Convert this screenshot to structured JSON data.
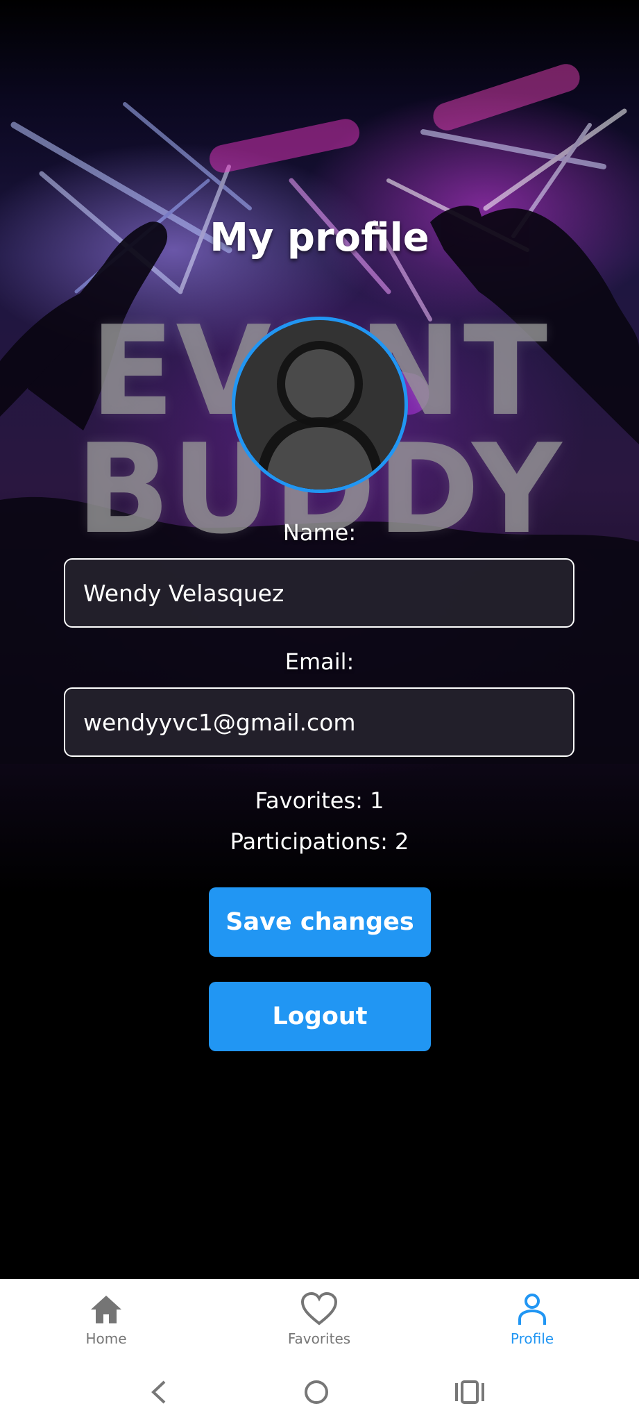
{
  "app": {
    "title": "My profile",
    "watermark_line1": "EVENT",
    "watermark_line2": "BUDDY"
  },
  "profile": {
    "name_label": "Name:",
    "name_value": "Wendy Velasquez",
    "email_label": "Email:",
    "email_value": "wendyyvc1@gmail.com",
    "favorites_text": "Favorites: 1",
    "participations_text": "Participations: 2",
    "avatar_icon": "person-icon"
  },
  "actions": {
    "save_label": "Save changes",
    "logout_label": "Logout"
  },
  "bottom_nav": {
    "items": [
      {
        "label": "Home",
        "icon": "home-icon",
        "active": false
      },
      {
        "label": "Favorites",
        "icon": "heart-icon",
        "active": false
      },
      {
        "label": "Profile",
        "icon": "person-icon",
        "active": true
      }
    ]
  },
  "system_nav": {
    "back": "back-icon",
    "home": "home-circle-icon",
    "recents": "recents-icon"
  },
  "colors": {
    "accent": "#2196f3",
    "background": "#000000",
    "nav_inactive": "#777777"
  }
}
